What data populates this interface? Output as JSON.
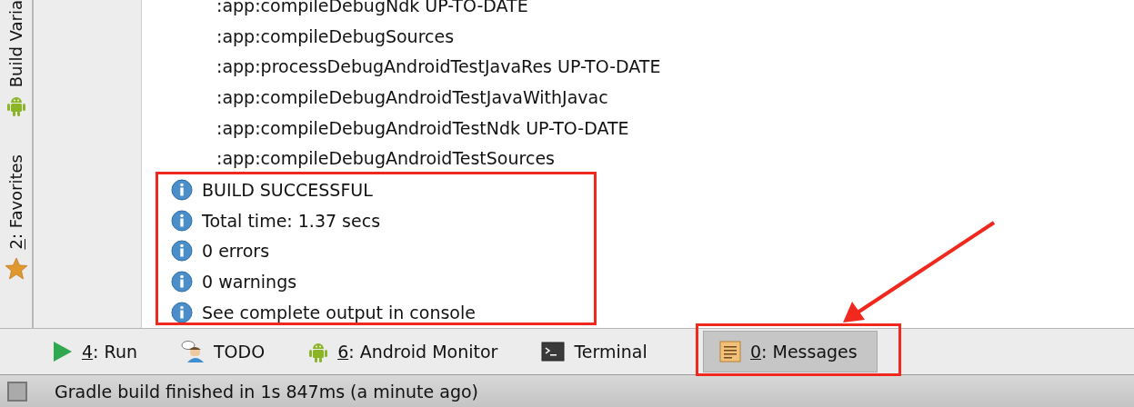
{
  "left_strip": [
    {
      "kind": "android",
      "label": "Build Varia"
    },
    {
      "kind": "star",
      "mnemonic": "2",
      "label": ": Favorites"
    }
  ],
  "log_lines": [
    ":app:compileDebugNdk UP-TO-DATE",
    ":app:compileDebugSources",
    ":app:processDebugAndroidTestJavaRes UP-TO-DATE",
    ":app:compileDebugAndroidTestJavaWithJavac",
    ":app:compileDebugAndroidTestNdk UP-TO-DATE",
    ":app:compileDebugAndroidTestSources"
  ],
  "messages": [
    {
      "kind": "info",
      "text": "BUILD SUCCESSFUL"
    },
    {
      "kind": "info",
      "text": "Total time: 1.37 secs"
    },
    {
      "kind": "info",
      "text": "0 errors"
    },
    {
      "kind": "info",
      "text": "0 warnings"
    },
    {
      "kind": "info",
      "text": "See complete output in console"
    }
  ],
  "tool_tabs": [
    {
      "kind": "run",
      "mnemonic": "4",
      "label": ": Run",
      "selected": false
    },
    {
      "kind": "todo",
      "label": "TODO",
      "selected": false
    },
    {
      "kind": "android",
      "mnemonic": "6",
      "label": ": Android Monitor",
      "selected": false
    },
    {
      "kind": "terminal",
      "label": "Terminal",
      "selected": false
    },
    {
      "kind": "messages",
      "mnemonic": "0",
      "label": ": Messages",
      "selected": true
    }
  ],
  "status_bar": {
    "text": "Gradle build finished in 1s 847ms (a minute ago)"
  },
  "annotations": [
    {
      "kind": "box"
    },
    {
      "kind": "box"
    },
    {
      "kind": "arrow"
    }
  ]
}
